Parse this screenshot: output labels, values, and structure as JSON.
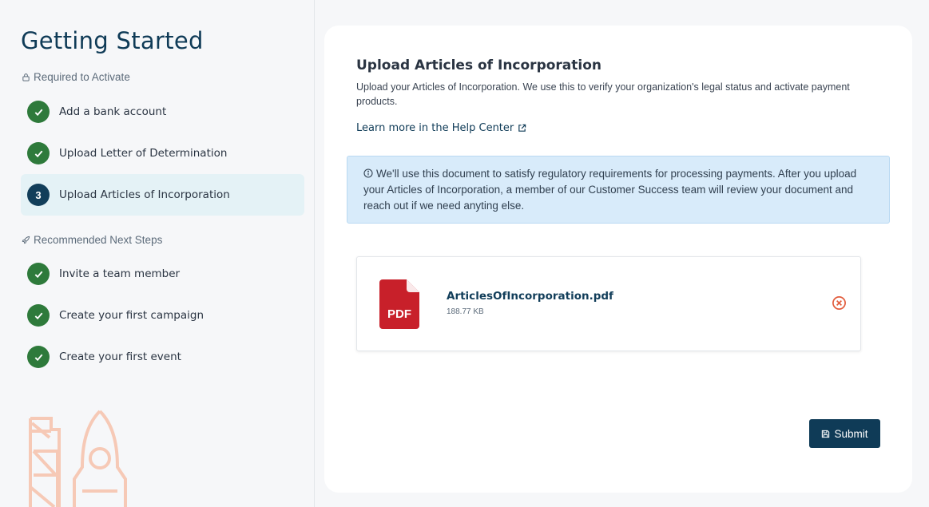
{
  "sidebar": {
    "title": "Getting Started",
    "required_label": "Required to Activate",
    "required_steps": [
      {
        "label": "Add a bank account",
        "status": "done"
      },
      {
        "label": "Upload Letter of Determination",
        "status": "done"
      },
      {
        "label": "Upload Articles of Incorporation",
        "status": "current",
        "number": "3"
      }
    ],
    "recommended_label": "Recommended Next Steps",
    "recommended_steps": [
      {
        "label": "Invite a team member",
        "status": "done"
      },
      {
        "label": "Create your first campaign",
        "status": "done"
      },
      {
        "label": "Create your first event",
        "status": "done"
      }
    ]
  },
  "main": {
    "title": "Upload Articles of Incorporation",
    "description": "Upload your Articles of Incorporation. We use this to verify your organization's legal status and activate payment products.",
    "help_link": "Learn more in the Help Center",
    "info_text": "We'll use this document to satisfy regulatory requirements for processing payments. After you upload your Articles of Incorporation, a member of our Customer Success team will review your document and reach out if we need anyting else.",
    "file": {
      "name": "ArticlesOfIncorporation.pdf",
      "size": "188.77 KB",
      "icon_text": "PDF"
    },
    "submit_label": "Submit"
  },
  "colors": {
    "brand": "#0f3b57",
    "done": "#2e7a3b",
    "pdf_red": "#c8202a",
    "remove": "#e25c3c",
    "info_bg": "#d8ebfa"
  }
}
